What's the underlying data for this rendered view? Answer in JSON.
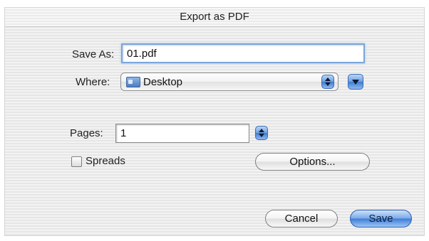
{
  "dialog": {
    "title": "Export as PDF"
  },
  "save_as": {
    "label": "Save As:",
    "value": "01.pdf"
  },
  "where": {
    "label": "Where:",
    "selected": "Desktop",
    "icon": "folder-icon"
  },
  "pages": {
    "label": "Pages:",
    "value": "1"
  },
  "spreads": {
    "label": "Spreads",
    "checked": false
  },
  "buttons": {
    "options": "Options...",
    "cancel": "Cancel",
    "save": "Save"
  },
  "colors": {
    "accent": "#3f7bd6",
    "focus_ring": "#7aa6dc"
  }
}
